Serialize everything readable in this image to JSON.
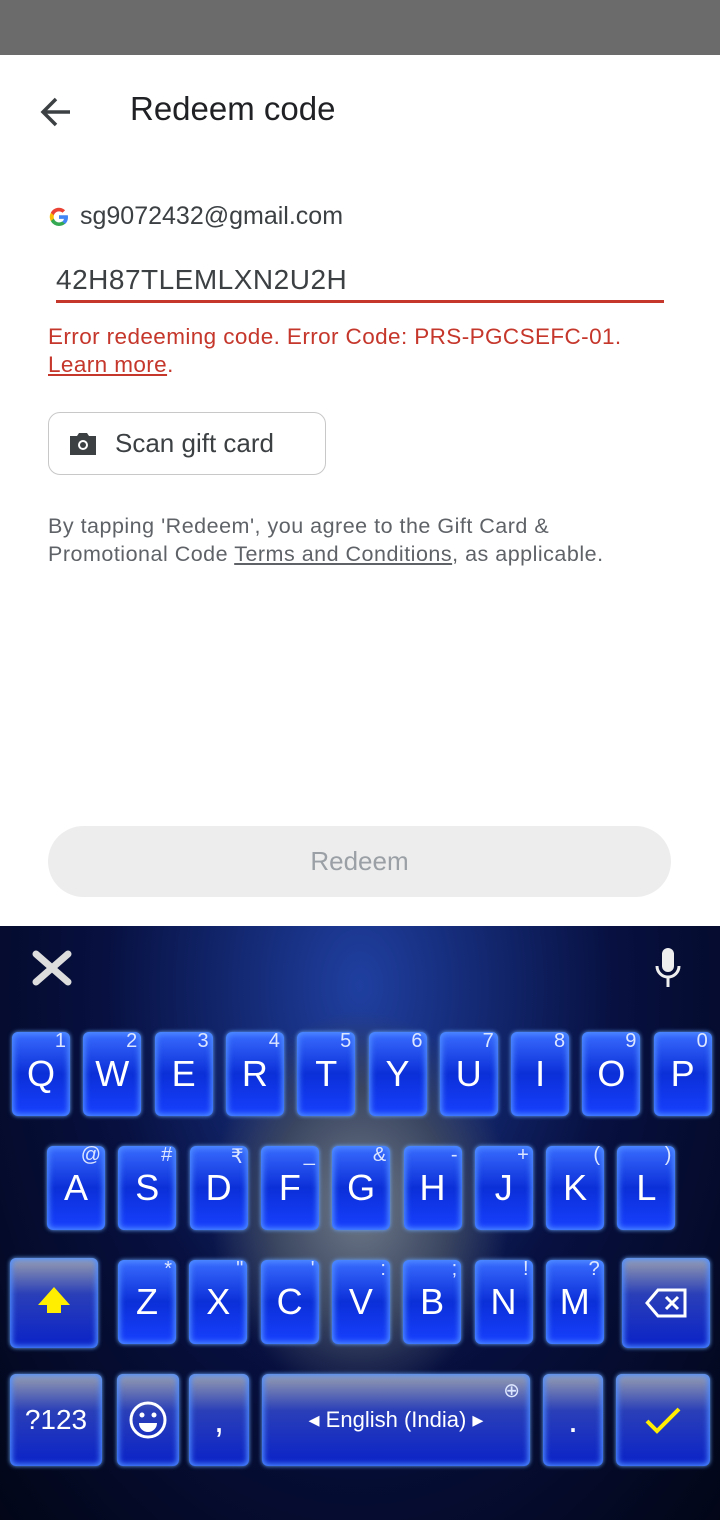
{
  "header": {
    "title": "Redeem code",
    "back_icon": "arrow-left-icon"
  },
  "account": {
    "email": "sg9072432@gmail.com",
    "icon": "google-g-icon"
  },
  "code_input": {
    "value": "42H87TLEMLXN2U2H",
    "underline_color": "#c5362b"
  },
  "error": {
    "message": "Error redeeming code. Error Code: PRS-PGCSEFC-01.",
    "link": "Learn more",
    "period": ".",
    "color": "#c5362b"
  },
  "scan_button": {
    "label": "Scan gift card",
    "icon": "camera-icon"
  },
  "terms": {
    "before": "By tapping 'Redeem', you agree to the Gift Card & Promotional Code ",
    "link": "Terms and Conditions",
    "after": ", as applicable."
  },
  "redeem_button": {
    "label": "Redeem"
  },
  "keyboard": {
    "row1": [
      {
        "k": "Q",
        "h": "1"
      },
      {
        "k": "W",
        "h": "2"
      },
      {
        "k": "E",
        "h": "3"
      },
      {
        "k": "R",
        "h": "4"
      },
      {
        "k": "T",
        "h": "5"
      },
      {
        "k": "Y",
        "h": "6"
      },
      {
        "k": "U",
        "h": "7"
      },
      {
        "k": "I",
        "h": "8"
      },
      {
        "k": "O",
        "h": "9"
      },
      {
        "k": "P",
        "h": "0"
      }
    ],
    "row2": [
      {
        "k": "A",
        "h": "@"
      },
      {
        "k": "S",
        "h": "#"
      },
      {
        "k": "D",
        "h": "₹"
      },
      {
        "k": "F",
        "h": "_"
      },
      {
        "k": "G",
        "h": "&"
      },
      {
        "k": "H",
        "h": "-"
      },
      {
        "k": "J",
        "h": "+"
      },
      {
        "k": "K",
        "h": "("
      },
      {
        "k": "L",
        "h": ")"
      }
    ],
    "row3": [
      {
        "k": "Z",
        "h": "*"
      },
      {
        "k": "X",
        "h": "\""
      },
      {
        "k": "C",
        "h": "'"
      },
      {
        "k": "V",
        "h": ":"
      },
      {
        "k": "B",
        "h": ";"
      },
      {
        "k": "N",
        "h": "!"
      },
      {
        "k": "M",
        "h": "?"
      }
    ],
    "symbols": "?123",
    "comma": ",",
    "period": ".",
    "space": "English (India)",
    "shift_icon": "shift-arrow-icon",
    "backspace_icon": "backspace-icon",
    "emoji_icon": "emoji-icon",
    "enter_icon": "checkmark-icon",
    "mic_icon": "microphone-icon",
    "tools_icon": "crossbones-icon",
    "globe_icon": "globe-icon"
  }
}
